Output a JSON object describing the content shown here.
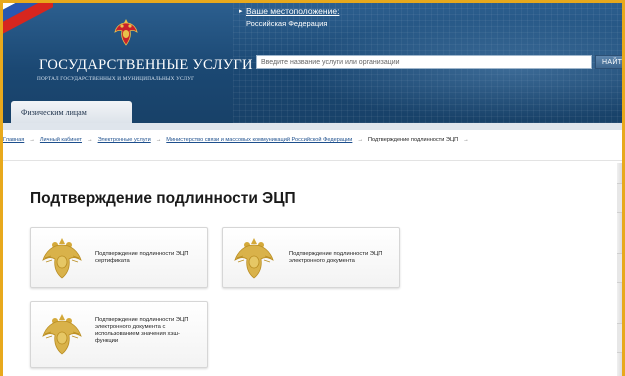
{
  "header": {
    "site_title": "ГОСУДАРСТВЕННЫЕ УСЛУГИ",
    "site_subtitle": "ПОРТАЛ ГОСУДАРСТВЕННЫХ И МУНИЦИПАЛЬНЫХ УСЛУГ",
    "location_link": "Ваше местоположение:",
    "region": "Российская Федерация",
    "search_placeholder": "Введите название услуги или организации",
    "search_button": "НАЙТИ",
    "nav_tab": "Физическим лицам"
  },
  "breadcrumb": {
    "items": [
      "Главная",
      "Личный кабинет",
      "Электронные услуги",
      "Министерство связи и массовых коммуникаций Российской Федерации"
    ],
    "separator": "→",
    "current": "Подтверждение подлинности ЭЦП",
    "trailing": "→"
  },
  "main": {
    "title": "Подтверждение подлинности ЭЦП",
    "cards": [
      {
        "label": "Подтверждение подлинности ЭЦП сертификата"
      },
      {
        "label": "Подтверждение подлинности ЭЦП электронного документа"
      },
      {
        "label": "Подтверждение подлинности ЭЦП электронного документа с использованием значения хэш-функции"
      }
    ]
  },
  "colors": {
    "border_accent": "#e8a91c",
    "header_blue": "#1b4873",
    "emblem_gold": "#d4a93a"
  },
  "icons": [
    "russian-flag-icon",
    "coat-of-arms-icon"
  ]
}
